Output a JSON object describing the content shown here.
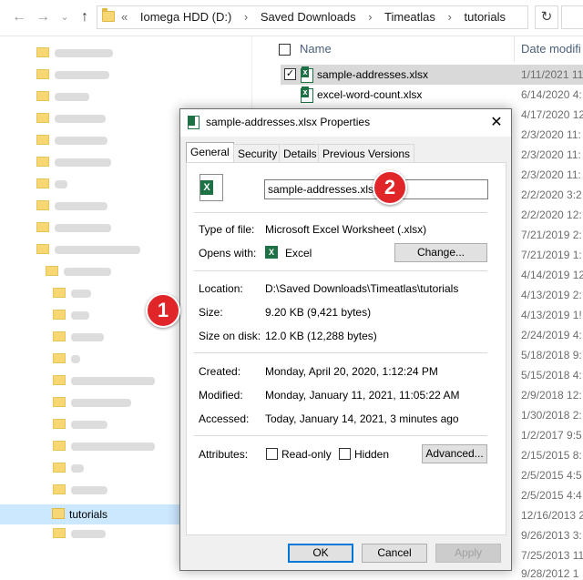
{
  "address_bar": {
    "overflow": "«",
    "crumbs": [
      "Iomega HDD (D:)",
      "Saved Downloads",
      "Timeatlas",
      "tutorials"
    ]
  },
  "nav_pane": {
    "selected_folder": "tutorials"
  },
  "file_list": {
    "headers": {
      "name": "Name",
      "date": "Date modifi"
    },
    "files": [
      {
        "name": "sample-addresses.xlsx",
        "date": "1/11/2021 11"
      },
      {
        "name": "excel-word-count.xlsx",
        "date": "6/14/2020 4:"
      }
    ],
    "dates": [
      "4/17/2020 12",
      "2/3/2020 11:",
      "2/3/2020 11:",
      "2/3/2020 11:",
      "2/2/2020 3:2",
      "2/2/2020 12:",
      "7/21/2019 2:",
      "7/21/2019 1:",
      "4/14/2019 12",
      "4/13/2019 2:",
      "4/13/2019 1!",
      "2/24/2019 4:",
      "5/18/2018 9:",
      "5/15/2018 4:",
      "2/9/2018 12:",
      "1/30/2018 2:",
      "1/2/2017 9:5",
      "2/15/2015 8:",
      "2/5/2015 4:5",
      "2/5/2015 4:4",
      "12/16/2013 2",
      "9/26/2013 3:",
      "7/25/2013 11",
      "9/28/2012 1"
    ]
  },
  "dialog": {
    "title": "sample-addresses.xlsx Properties",
    "close": "✕",
    "tabs": [
      "General",
      "Security",
      "Details",
      "Previous Versions"
    ],
    "file_name_value": "sample-addresses.xlsx",
    "type_label": "Type of file:",
    "type_value": "Microsoft Excel Worksheet (.xlsx)",
    "opens_label": "Opens with:",
    "opens_value": "Excel",
    "change_button": "Change...",
    "location_label": "Location:",
    "location_value": "D:\\Saved Downloads\\Timeatlas\\tutorials",
    "size_label": "Size:",
    "size_value": "9.20 KB (9,421 bytes)",
    "size_disk_label": "Size on disk:",
    "size_disk_value": "12.0 KB (12,288 bytes)",
    "created_label": "Created:",
    "created_value": "Monday, April 20, 2020, 1:12:24 PM",
    "modified_label": "Modified:",
    "modified_value": "Monday, January 11, 2021, 11:05:22 AM",
    "accessed_label": "Accessed:",
    "accessed_value": "Today, January 14, 2021, 3 minutes ago",
    "attributes_label": "Attributes:",
    "readonly_label": "Read-only",
    "hidden_label": "Hidden",
    "advanced_button": "Advanced...",
    "ok_button": "OK",
    "cancel_button": "Cancel",
    "apply_button": "Apply"
  },
  "callouts": {
    "one": "1",
    "two": "2"
  },
  "colors": {
    "callout_red": "#e1262a",
    "selection_blue": "#cce8ff",
    "excel_green": "#1e7145"
  }
}
